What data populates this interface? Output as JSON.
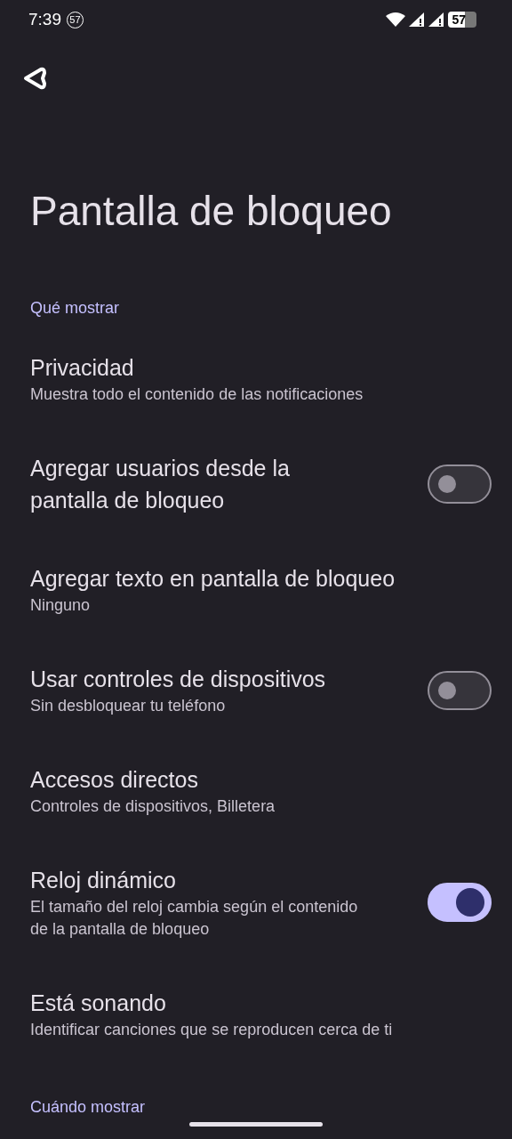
{
  "status_bar": {
    "time": "7:39",
    "notification_count": "57",
    "battery": "57"
  },
  "title": "Pantalla de bloqueo",
  "sections": [
    {
      "header": "Qué mostrar",
      "items": [
        {
          "kind": "text",
          "title": "Privacidad",
          "subtitle": "Muestra todo el contenido de las notificaciones"
        },
        {
          "kind": "toggle",
          "title": "Agregar usuarios desde la pantalla de bloqueo",
          "on": false
        },
        {
          "kind": "text",
          "title": "Agregar texto en pantalla de bloqueo",
          "subtitle": "Ninguno"
        },
        {
          "kind": "toggle",
          "title": "Usar controles de dispositivos",
          "subtitle": "Sin desbloquear tu teléfono",
          "on": false
        },
        {
          "kind": "text",
          "title": "Accesos directos",
          "subtitle": "Controles de dispositivos, Billetera"
        },
        {
          "kind": "toggle",
          "title": "Reloj dinámico",
          "subtitle": "El tamaño del reloj cambia según el contenido de la pantalla de bloqueo",
          "on": true
        },
        {
          "kind": "text",
          "title": "Está sonando",
          "subtitle": "Identificar canciones que se reproducen cerca de ti"
        }
      ]
    },
    {
      "header": "Cuándo mostrar"
    }
  ]
}
